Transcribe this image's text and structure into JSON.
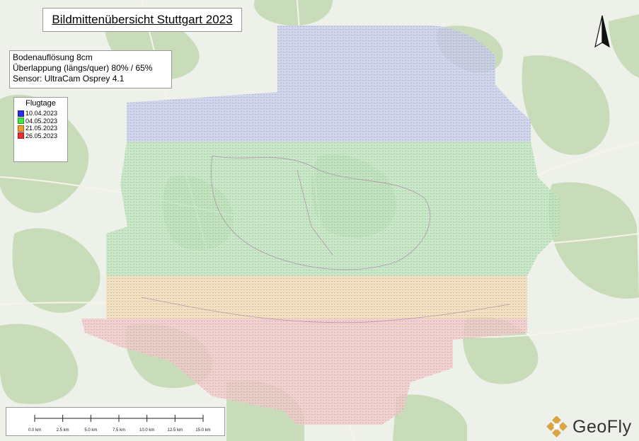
{
  "title": "Bildmittenübersicht Stuttgart 2023",
  "info": {
    "lines": [
      "Bodenauflösung 8cm",
      "Überlappung (längs/quer) 80% / 65%",
      "Sensor: UltraCam Osprey 4.1"
    ]
  },
  "legend": {
    "title": "Flugtage",
    "items": [
      {
        "label": "10.04.2023",
        "color": "#2b2bf0"
      },
      {
        "label": "04.05.2023",
        "color": "#3ee83e"
      },
      {
        "label": "21.05.2023",
        "color": "#f59a2a"
      },
      {
        "label": "26.05.2023",
        "color": "#f02d2d"
      }
    ]
  },
  "scale_bar": {
    "ticks": [
      "0.0 km",
      "2.5 km",
      "5.0 km",
      "7.5 km",
      "10.0 km",
      "12.5 km",
      "15.0 km"
    ]
  },
  "logo": {
    "text": "GeoFly",
    "color": "#d9a441"
  },
  "colors": {
    "basemap": "#eef1ea",
    "forest": "#c6dab7",
    "blue_points": "#7f86e8",
    "green_points": "#7bd67b",
    "orange_points": "#f0b870",
    "red_points": "#ef8a8a"
  }
}
